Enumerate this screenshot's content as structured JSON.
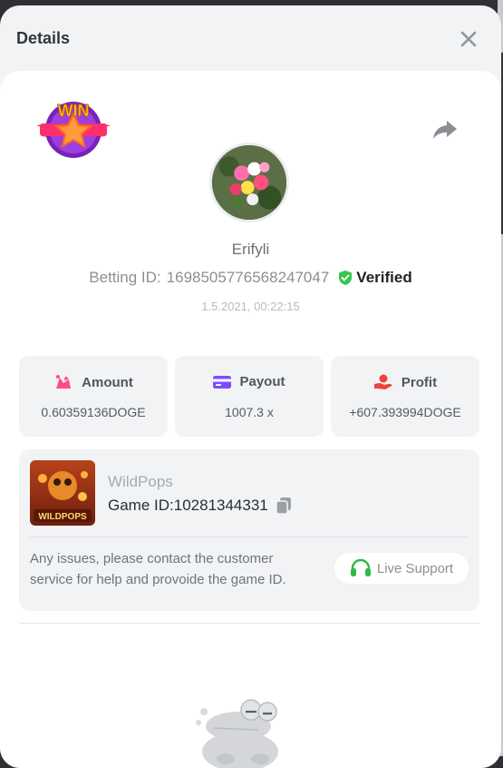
{
  "modal": {
    "title": "Details"
  },
  "user": {
    "name": "Erifyli",
    "betting_id_label": "Betting ID:",
    "betting_id": "1698505776568247047",
    "verified_label": "Verified",
    "timestamp": "1.5.2021, 00:22:15"
  },
  "badge": {
    "text": "WIN"
  },
  "stats": [
    {
      "label": "Amount",
      "value": "0.60359136DOGE",
      "icon": "amount-icon"
    },
    {
      "label": "Payout",
      "value": "1007.3 x",
      "icon": "payout-card-icon"
    },
    {
      "label": "Profit",
      "value": "+607.393994DOGE",
      "icon": "profit-hand-icon"
    }
  ],
  "game": {
    "name": "WildPops",
    "id_label": "Game ID:",
    "id": "10281344331",
    "thumb_text": "WILDPOPS",
    "issues_text": "Any issues, please contact the customer service for help and provoide the game ID.",
    "support_label": "Live Support"
  },
  "colors": {
    "accent_green": "#35c64a",
    "payout_purple": "#7b4dff",
    "profit_red": "#f0413c",
    "amount_pink": "#ff4b8a"
  }
}
